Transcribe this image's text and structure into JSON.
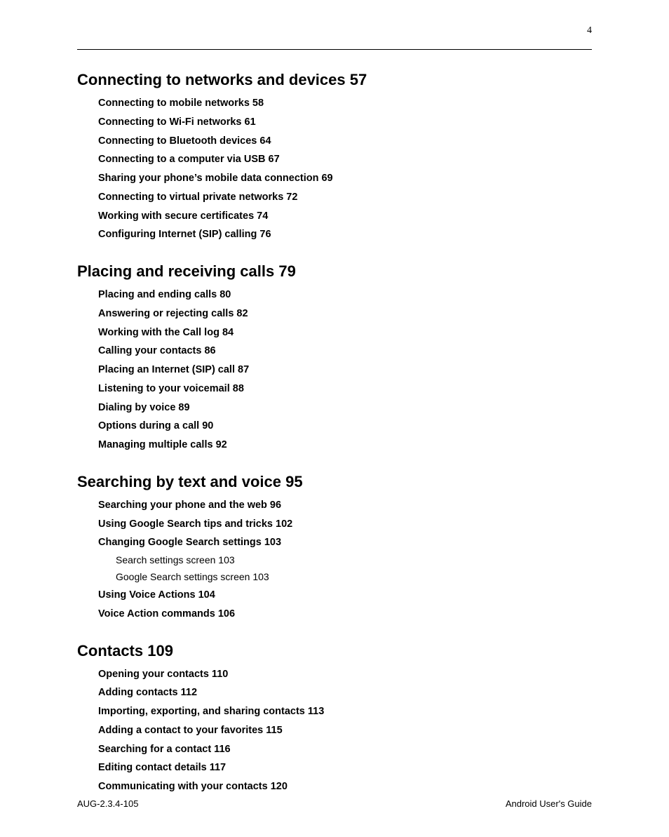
{
  "page": {
    "number": "4",
    "footer_left": "AUG-2.3.4-105",
    "footer_right": "Android User's Guide"
  },
  "sections": [
    {
      "heading": "Connecting to networks and devices 57",
      "items": [
        {
          "label": "Connecting to mobile networks 58",
          "indent": "item"
        },
        {
          "label": "Connecting to Wi-Fi networks 61",
          "indent": "item"
        },
        {
          "label": "Connecting to Bluetooth devices 64",
          "indent": "item"
        },
        {
          "label": "Connecting to a computer via USB 67",
          "indent": "item"
        },
        {
          "label": "Sharing your phone’s mobile data connection 69",
          "indent": "item"
        },
        {
          "label": "Connecting to virtual private networks 72",
          "indent": "item"
        },
        {
          "label": "Working with secure certificates 74",
          "indent": "item"
        },
        {
          "label": "Configuring Internet (SIP) calling 76",
          "indent": "item"
        }
      ]
    },
    {
      "heading": "Placing and receiving calls 79",
      "items": [
        {
          "label": "Placing and ending calls 80",
          "indent": "item"
        },
        {
          "label": "Answering or rejecting calls 82",
          "indent": "item"
        },
        {
          "label": "Working with the Call log 84",
          "indent": "item"
        },
        {
          "label": "Calling your contacts 86",
          "indent": "item"
        },
        {
          "label": "Placing an Internet (SIP) call 87",
          "indent": "item"
        },
        {
          "label": "Listening to your voicemail 88",
          "indent": "item"
        },
        {
          "label": "Dialing by voice 89",
          "indent": "item"
        },
        {
          "label": "Options during a call 90",
          "indent": "item"
        },
        {
          "label": "Managing multiple calls 92",
          "indent": "item"
        }
      ]
    },
    {
      "heading": "Searching by text and voice 95",
      "items": [
        {
          "label": "Searching your phone and the web 96",
          "indent": "item"
        },
        {
          "label": "Using Google Search tips and tricks 102",
          "indent": "item"
        },
        {
          "label": "Changing Google Search settings 103",
          "indent": "item"
        },
        {
          "label": "Search settings screen 103",
          "indent": "subitem"
        },
        {
          "label": "Google Search settings screen 103",
          "indent": "subitem"
        },
        {
          "label": "Using Voice Actions 104",
          "indent": "item"
        },
        {
          "label": "Voice Action commands 106",
          "indent": "item"
        }
      ]
    },
    {
      "heading": "Contacts 109",
      "items": [
        {
          "label": "Opening your contacts 110",
          "indent": "item"
        },
        {
          "label": "Adding contacts 112",
          "indent": "item"
        },
        {
          "label": "Importing, exporting, and sharing contacts 113",
          "indent": "item"
        },
        {
          "label": "Adding a contact to your favorites 115",
          "indent": "item"
        },
        {
          "label": "Searching for a contact 116",
          "indent": "item"
        },
        {
          "label": "Editing contact details 117",
          "indent": "item"
        },
        {
          "label": "Communicating with your contacts 120",
          "indent": "item"
        }
      ]
    }
  ]
}
